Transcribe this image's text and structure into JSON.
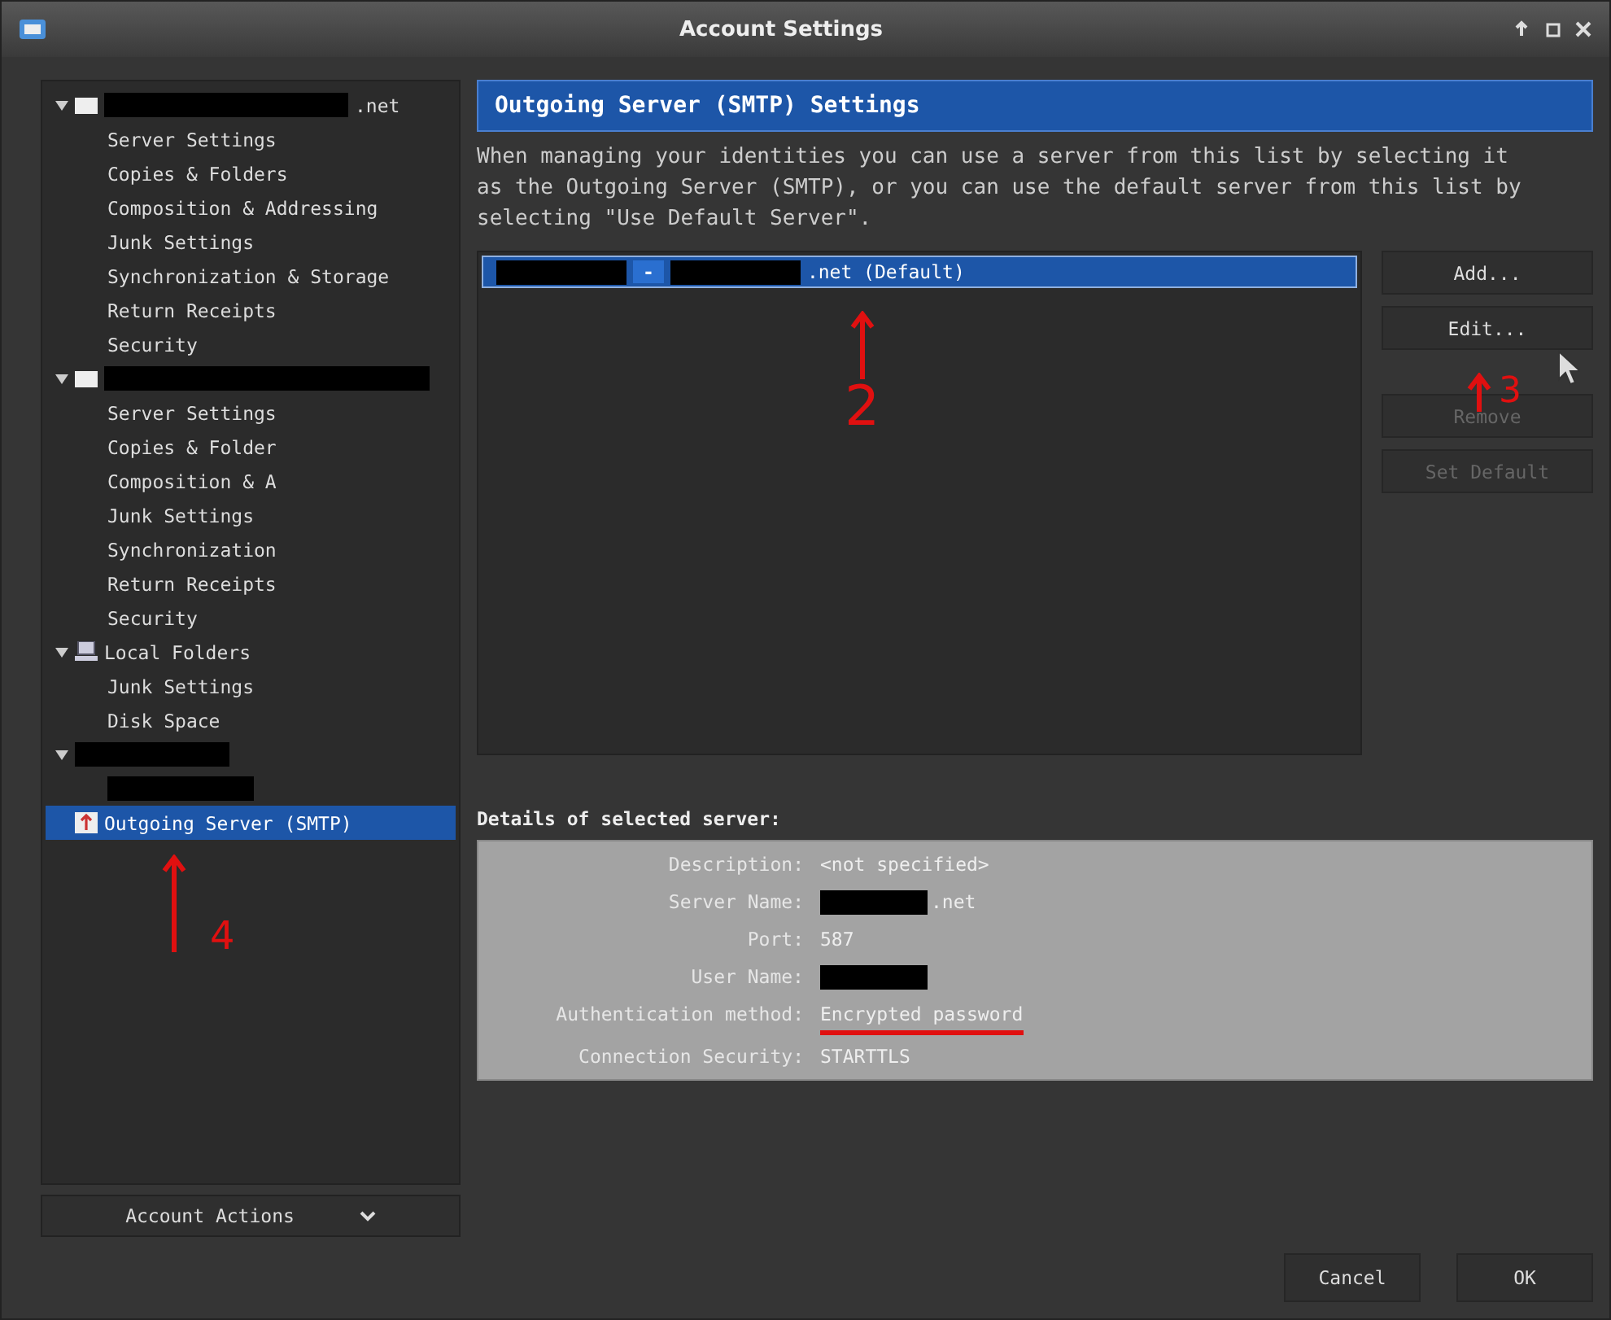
{
  "window": {
    "title": "Account Settings"
  },
  "tree": [
    {
      "kind": "account",
      "segments": [
        {
          "kind": "redacted"
        },
        {
          "kind": "text",
          "text": ".net"
        }
      ],
      "expanded": true,
      "selected": false,
      "children": [
        {
          "label": "Server Settings",
          "selected": false
        },
        {
          "label": "Copies & Folders",
          "selected": false
        },
        {
          "label": "Composition & Addressing",
          "selected": false
        },
        {
          "label": "Junk Settings",
          "selected": false
        },
        {
          "label": "Synchronization & Storage",
          "selected": false
        },
        {
          "label": "Return Receipts",
          "selected": false
        },
        {
          "label": "Security",
          "selected": false
        }
      ]
    },
    {
      "kind": "account",
      "segments": [
        {
          "kind": "redacted"
        }
      ],
      "expanded": true,
      "selected": false,
      "children": [
        {
          "label": "Server Settings",
          "selected": false
        },
        {
          "label": "Copies & Folder",
          "selected": false
        },
        {
          "label": "Composition & A",
          "selected": false
        },
        {
          "label": "Junk Settings",
          "selected": false
        },
        {
          "label": "Synchronization",
          "selected": false
        },
        {
          "label": "Return Receipts",
          "selected": false
        },
        {
          "label": "Security",
          "selected": false
        }
      ]
    },
    {
      "kind": "local",
      "segments": [
        {
          "kind": "text",
          "text": "Local Folders"
        }
      ],
      "expanded": true,
      "selected": false,
      "children": [
        {
          "label": "Junk Settings",
          "selected": false
        },
        {
          "label": "Disk Space",
          "selected": false
        }
      ]
    },
    {
      "kind": "redacted",
      "segments": [
        {
          "kind": "redacted"
        }
      ],
      "expanded": true,
      "selected": false
    },
    {
      "kind": "smtp",
      "segments": [
        {
          "kind": "text",
          "text": "Outgoing Server (SMTP)"
        }
      ],
      "expanded": false,
      "selected": true
    }
  ],
  "account_actions": "Account Actions",
  "heading": "Outgoing Server (SMTP) Settings",
  "description": "When managing your identities you can use a server from this list by selecting it as the Outgoing Server (SMTP), or you can use the default server from this list by selecting \"Use Default Server\".",
  "servers": [
    {
      "selected": true,
      "segments": [
        {
          "kind": "redacted"
        },
        {
          "kind": "chip",
          "text": "-"
        },
        {
          "kind": "redacted"
        },
        {
          "kind": "text",
          "text": ".net (Default)"
        }
      ]
    }
  ],
  "side_buttons": [
    {
      "label": "Add...",
      "disabled": false
    },
    {
      "label": "Edit...",
      "disabled": false
    },
    {
      "label": "Remove",
      "disabled": true
    },
    {
      "label": "Set Default",
      "disabled": true
    }
  ],
  "details_title": "Details of selected server:",
  "details": [
    {
      "label": "Description:",
      "segments": [
        {
          "kind": "text",
          "text": "<not specified>"
        }
      ],
      "underlined": false
    },
    {
      "label": "Server Name:",
      "segments": [
        {
          "kind": "redacted"
        },
        {
          "kind": "text",
          "text": ".net"
        }
      ],
      "underlined": false
    },
    {
      "label": "Port:",
      "segments": [
        {
          "kind": "text",
          "text": "587"
        }
      ],
      "underlined": false
    },
    {
      "label": "User Name:",
      "segments": [
        {
          "kind": "redacted"
        }
      ],
      "underlined": false
    },
    {
      "label": "Authentication method:",
      "segments": [
        {
          "kind": "text",
          "text": "Encrypted password"
        }
      ],
      "underlined": true
    },
    {
      "label": "Connection Security:",
      "segments": [
        {
          "kind": "text",
          "text": "STARTTLS"
        }
      ],
      "underlined": false
    }
  ],
  "footer_buttons": [
    "Cancel",
    "OK"
  ],
  "annotations": [
    {
      "kind": "server",
      "label": "2"
    },
    {
      "kind": "edit",
      "label": "3"
    },
    {
      "kind": "smtp",
      "label": "4"
    }
  ]
}
